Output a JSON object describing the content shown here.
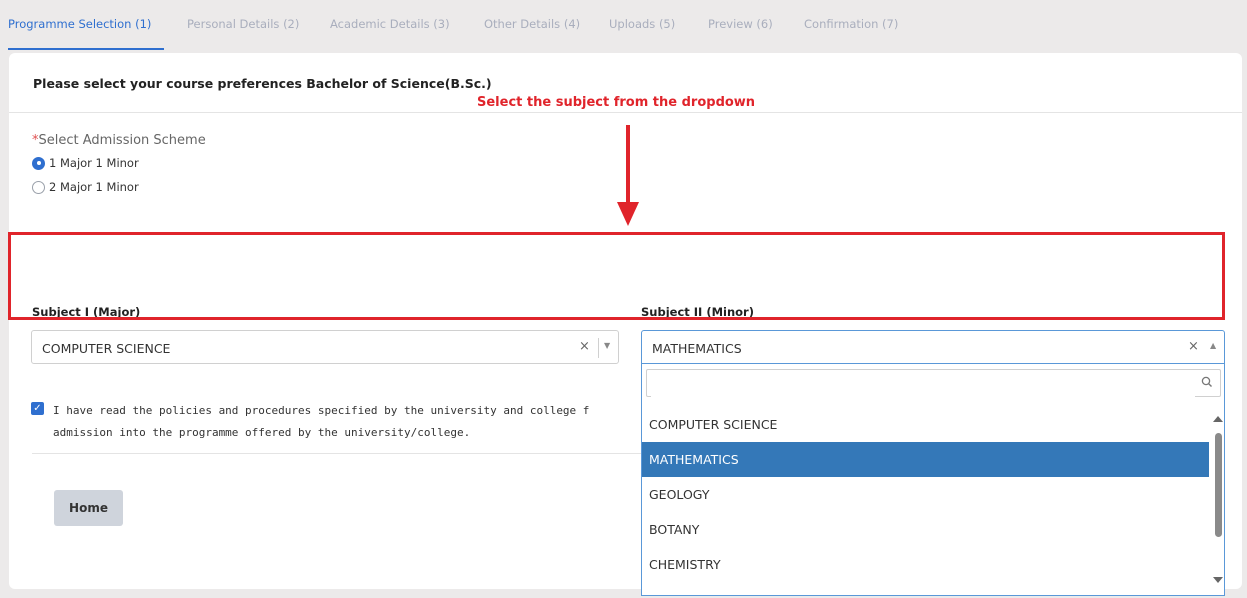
{
  "tabs": [
    {
      "label": "Programme Selection  (1)"
    },
    {
      "label": "Personal Details  (2)"
    },
    {
      "label": "Academic Details  (3)"
    },
    {
      "label": "Other Details  (4)"
    },
    {
      "label": "Uploads  (5)"
    },
    {
      "label": "Preview  (6)"
    },
    {
      "label": "Confirmation  (7)"
    }
  ],
  "form": {
    "heading": "Please select your course preferences Bachelor of Science(B.Sc.)",
    "scheme_required_mark": "*",
    "scheme_label": "Select Admission Scheme",
    "scheme_options": [
      {
        "label": "1 Major 1 Minor",
        "selected": true
      },
      {
        "label": "2 Major 1 Minor",
        "selected": false
      }
    ],
    "subject1": {
      "label": "Subject I (Major)",
      "value": "COMPUTER SCIENCE"
    },
    "subject2": {
      "label": "Subject II (Minor)",
      "value": "MATHEMATICS"
    },
    "policy_text": "I have read the policies and procedures specified by the university and college f\nadmission into the programme offered by the university/college.",
    "policy_checked": true,
    "home_button": "Home"
  },
  "annotation": {
    "text": "Select the subject from the dropdown",
    "color": "#e0242b"
  },
  "dropdown": {
    "search_value": "",
    "options": [
      "COMPUTER SCIENCE",
      "MATHEMATICS",
      "GEOLOGY",
      "BOTANY",
      "CHEMISTRY"
    ],
    "selected": "MATHEMATICS"
  },
  "colors": {
    "accent": "#2f6fcf",
    "selected_option": "#3478b8"
  }
}
